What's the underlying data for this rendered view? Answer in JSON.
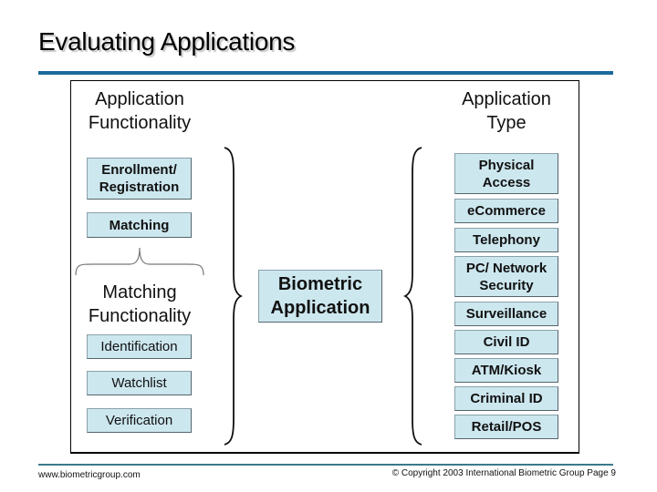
{
  "slide": {
    "title": "Evaluating Applications",
    "accent_color": "#1a6a9a",
    "box_fill_color": "#cde7ef"
  },
  "diagram": {
    "left_column": {
      "heading_line1": "Application",
      "heading_line2": "Functionality",
      "items": [
        {
          "line1": "Enrollment/",
          "line2": "Registration"
        },
        {
          "line1": "Matching",
          "line2": ""
        }
      ],
      "sub_heading_line1": "Matching",
      "sub_heading_line2": "Functionality",
      "sub_items": [
        "Identification",
        "Watchlist",
        "Verification"
      ]
    },
    "center": {
      "line1": "Biometric",
      "line2": "Application"
    },
    "right_column": {
      "heading_line1": "Application",
      "heading_line2": "Type",
      "items": [
        {
          "line1": "Physical",
          "line2": "Access"
        },
        {
          "line1": "eCommerce",
          "line2": ""
        },
        {
          "line1": "Telephony",
          "line2": ""
        },
        {
          "line1": "PC/ Network",
          "line2": "Security"
        },
        {
          "line1": "Surveillance",
          "line2": ""
        },
        {
          "line1": "Civil ID",
          "line2": ""
        },
        {
          "line1": "ATM/Kiosk",
          "line2": ""
        },
        {
          "line1": "Criminal ID",
          "line2": ""
        },
        {
          "line1": "Retail/POS",
          "line2": ""
        }
      ]
    }
  },
  "footer": {
    "website": "www.biometricgroup.com",
    "copyright": "© Copyright 2003 International Biometric Group  Page 9"
  }
}
